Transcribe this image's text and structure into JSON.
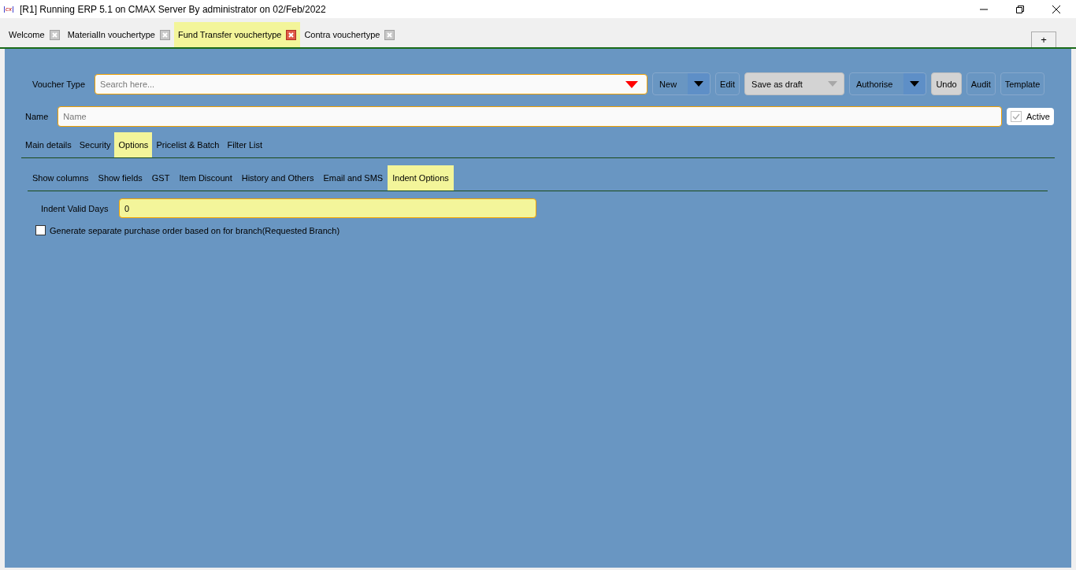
{
  "window": {
    "title": "[R1] Running ERP 5.1 on CMAX Server By administrator on 02/Feb/2022",
    "app_icon": "cx"
  },
  "tabs": [
    {
      "label": "Welcome",
      "selected": false
    },
    {
      "label": "MaterialIn vouchertype",
      "selected": false
    },
    {
      "label": "Fund Transfer vouchertype",
      "selected": true
    },
    {
      "label": "Contra vouchertype",
      "selected": false
    }
  ],
  "new_tab_button": "+",
  "voucher_type": {
    "label": "Voucher Type",
    "placeholder": "Search here..."
  },
  "buttons": [
    {
      "label": "New",
      "kind": "split",
      "shaded": false
    },
    {
      "label": "Edit",
      "kind": "plain",
      "shaded": false
    },
    {
      "label": "Save as draft",
      "kind": "split",
      "shaded": true
    },
    {
      "label": "Authorise",
      "kind": "split",
      "shaded": false
    },
    {
      "label": "Undo",
      "kind": "plain",
      "shaded": true
    },
    {
      "label": "Audit",
      "kind": "plain",
      "shaded": false
    },
    {
      "label": "Template",
      "kind": "plain",
      "shaded": false
    }
  ],
  "name_field": {
    "label": "Name",
    "placeholder": "Name"
  },
  "active": {
    "label": "Active",
    "checked": true
  },
  "section_tabs": [
    {
      "label": "Main details",
      "selected": false
    },
    {
      "label": "Security",
      "selected": false
    },
    {
      "label": "Options",
      "selected": true
    },
    {
      "label": "Pricelist & Batch",
      "selected": false
    },
    {
      "label": "Filter List",
      "selected": false
    }
  ],
  "option_tabs": [
    {
      "label": "Show columns",
      "selected": false
    },
    {
      "label": "Show fields",
      "selected": false
    },
    {
      "label": "GST",
      "selected": false
    },
    {
      "label": "Item Discount",
      "selected": false
    },
    {
      "label": "History and Others",
      "selected": false
    },
    {
      "label": "Email and SMS",
      "selected": false
    },
    {
      "label": "Indent Options",
      "selected": true
    }
  ],
  "indent_valid_days": {
    "label": "Indent Valid Days",
    "value": "0"
  },
  "generate_po": {
    "label": "Generate separate purchase order based on for branch(Requested Branch)",
    "checked": false
  }
}
